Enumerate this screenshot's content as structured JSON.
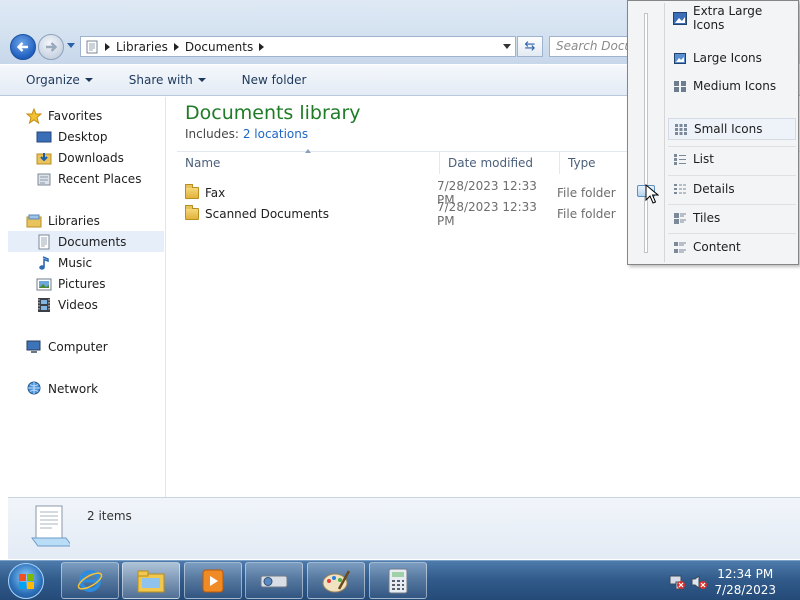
{
  "address": {
    "crumbs": [
      "Libraries",
      "Documents"
    ],
    "search_placeholder": "Search Documents"
  },
  "toolbar": {
    "organize": "Organize",
    "share_with": "Share with",
    "new_folder": "New folder"
  },
  "navigation": {
    "favorites": {
      "label": "Favorites",
      "items": [
        "Desktop",
        "Downloads",
        "Recent Places"
      ]
    },
    "libraries": {
      "label": "Libraries",
      "items": [
        "Documents",
        "Music",
        "Pictures",
        "Videos"
      ],
      "selected": "Documents"
    },
    "computer": "Computer",
    "network": "Network"
  },
  "library": {
    "title": "Documents library",
    "includes_label": "Includes:",
    "includes_link": "2 locations"
  },
  "columns": [
    "Name",
    "Date modified",
    "Type"
  ],
  "files": [
    {
      "name": "Fax",
      "date": "7/28/2023 12:33 PM",
      "type": "File folder"
    },
    {
      "name": "Scanned Documents",
      "date": "7/28/2023 12:33 PM",
      "type": "File folder"
    }
  ],
  "details": {
    "count": "2 items"
  },
  "view_menu": {
    "items": [
      "Extra Large Icons",
      "Large Icons",
      "Medium Icons",
      "Small Icons",
      "List",
      "Details",
      "Tiles",
      "Content"
    ],
    "current": "Small Icons"
  },
  "clock": {
    "time": "12:34 PM",
    "date": "7/28/2023"
  },
  "colors": {
    "library_title": "#1e7b26",
    "link": "#1e66c5",
    "taskbar": "#325c8c"
  }
}
